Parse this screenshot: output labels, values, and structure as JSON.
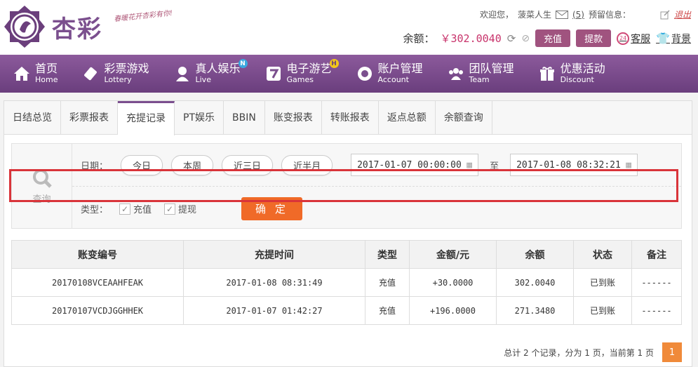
{
  "header": {
    "logo_text": "杏彩",
    "slogan": "春暖花开杏彩有你!",
    "welcome": "欢迎您，",
    "username": "菠菜人生",
    "mail_count": "(5)",
    "reserve_info": "预留信息：",
    "logout": "退出",
    "balance_label": "余额：",
    "balance_value": "￥302.0040",
    "recharge": "充值",
    "withdraw": "提款",
    "service": "客服",
    "background": "背景"
  },
  "nav": [
    {
      "zh": "首页",
      "en": "Home",
      "icon": "home-icon"
    },
    {
      "zh": "彩票游戏",
      "en": "Lottery",
      "icon": "lottery-icon"
    },
    {
      "zh": "真人娱乐",
      "en": "Live",
      "icon": "live-icon",
      "badge": "N"
    },
    {
      "zh": "电子游艺",
      "en": "Games",
      "icon": "games-icon",
      "badge": "H"
    },
    {
      "zh": "账户管理",
      "en": "Account",
      "icon": "account-icon"
    },
    {
      "zh": "团队管理",
      "en": "Team",
      "icon": "team-icon"
    },
    {
      "zh": "优惠活动",
      "en": "Discount",
      "icon": "gift-icon"
    }
  ],
  "tabs": [
    "日结总览",
    "彩票报表",
    "充提记录",
    "PT娱乐",
    "BBIN",
    "账变报表",
    "转账报表",
    "返点总额",
    "余额查询"
  ],
  "active_tab": 2,
  "query": {
    "label": "查询",
    "date_label": "日期：",
    "quick_dates": [
      "今日",
      "本周",
      "近三日",
      "近半月"
    ],
    "start": "2017-01-07 00:00:00",
    "to": "至",
    "end": "2017-01-08 08:32:21",
    "type_label": "类型：",
    "type_recharge": "充值",
    "type_withdraw": "提现",
    "confirm": "确 定"
  },
  "table": {
    "headers": [
      "账变编号",
      "充提时间",
      "类型",
      "金额/元",
      "余额",
      "状态",
      "备注"
    ],
    "rows": [
      {
        "id": "20170108VCEAAHFEAK",
        "time": "2017-01-08 08:31:49",
        "type": "充值",
        "amount": "+30.0000",
        "balance": "302.0040",
        "status": "已到账",
        "note": "------"
      },
      {
        "id": "20170107VCDJGGHHEK",
        "time": "2017-01-07 01:42:27",
        "type": "充值",
        "amount": "+196.0000",
        "balance": "271.3480",
        "status": "已到账",
        "note": "------"
      }
    ]
  },
  "pager": {
    "summary": "总计 2 个记录，分为 1 页，当前第 1 页",
    "current": "1"
  },
  "colors": {
    "brand": "#7b4f8e",
    "accent": "#f06a28",
    "highlight": "#d9343a",
    "amount": "#d0103a",
    "status": "#2a9a2a"
  }
}
